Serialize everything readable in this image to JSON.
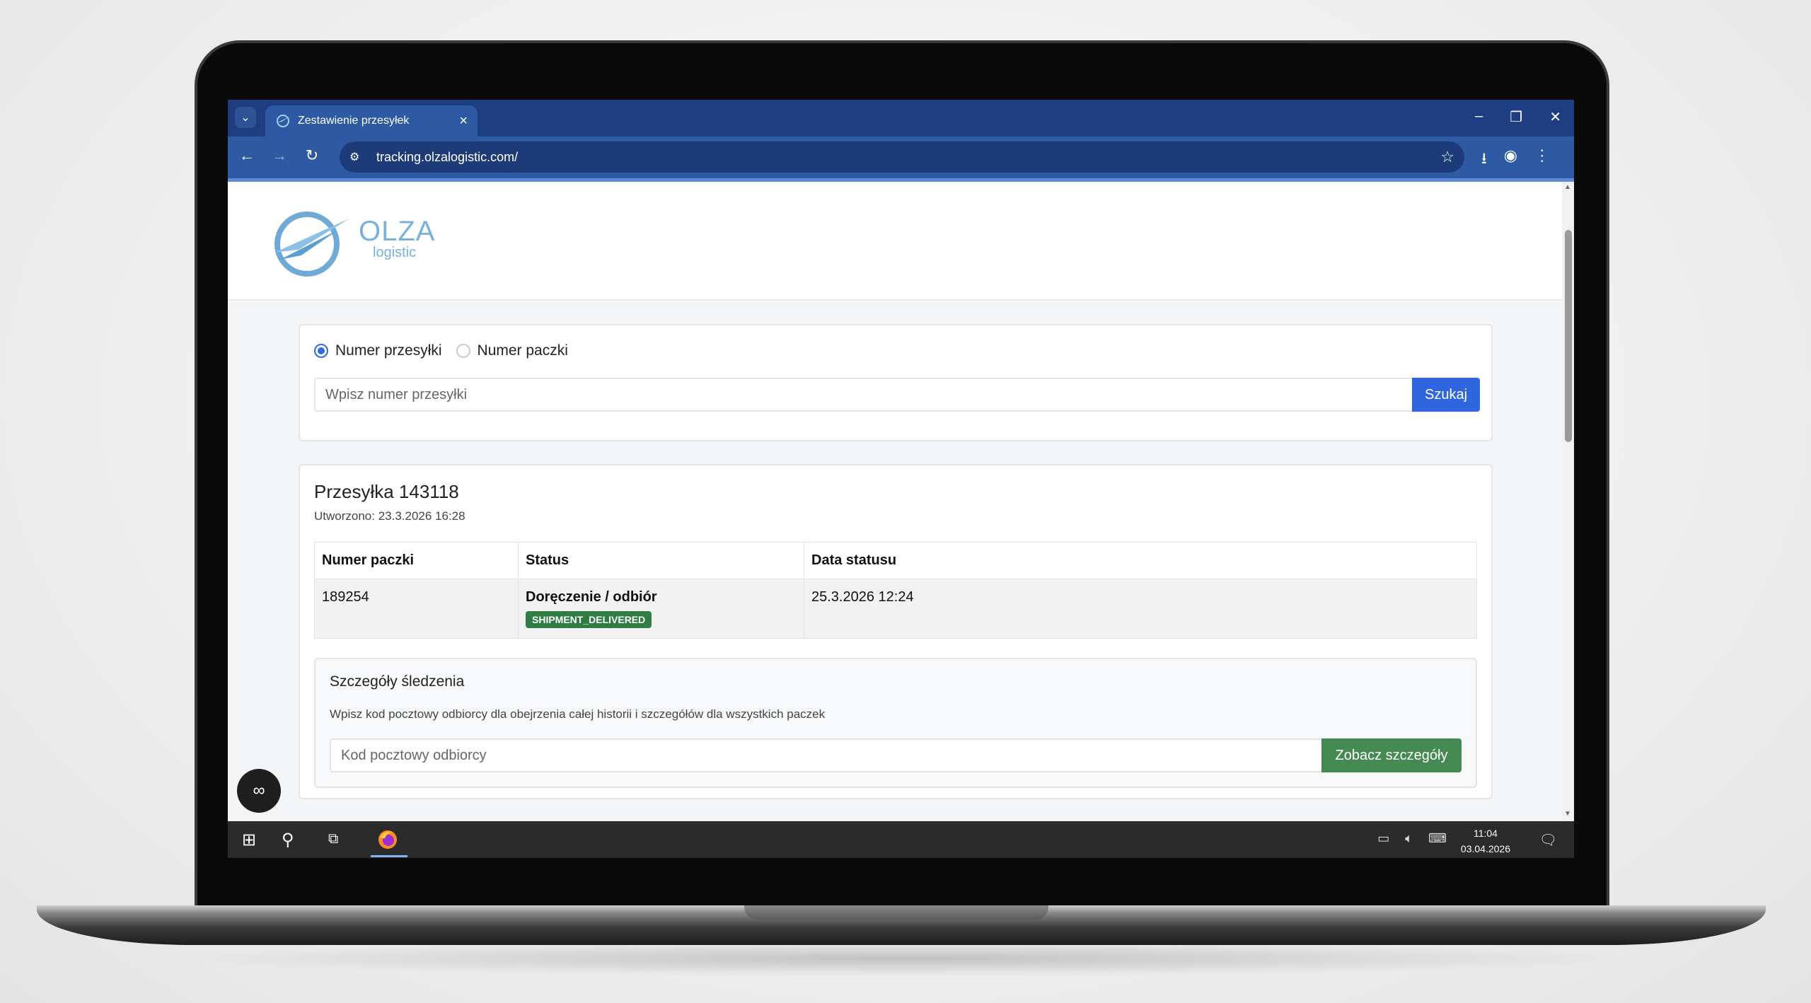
{
  "browser": {
    "tab_title": "Zestawienie przesyłek",
    "url": "tracking.olzalogistic.com/"
  },
  "logo": {
    "main": "OLZA",
    "sub": "logistic"
  },
  "search": {
    "radio_shipment": "Numer przesyłki",
    "radio_package": "Numer paczki",
    "placeholder": "Wpisz numer przesyłki",
    "button": "Szukaj"
  },
  "shipment": {
    "title": "Przesyłka 143118",
    "created": "Utworzono: 23.3.2026 16:28",
    "columns": [
      "Numer paczki",
      "Status",
      "Data statusu"
    ],
    "row": {
      "package": "189254",
      "status": "Doręczenie / odbiór",
      "badge": "SHIPMENT_DELIVERED",
      "date": "25.3.2026 12:24"
    }
  },
  "details": {
    "title": "Szczegóły śledzenia",
    "description": "Wpisz kod pocztowy odbiorcy dla obejrzenia całej historii i szczegółów dla wszystkich paczek",
    "placeholder": "Kod pocztowy odbiorcy",
    "button": "Zobacz szczegóły"
  },
  "taskbar": {
    "time": "11:04",
    "date": "03.04.2026"
  },
  "colors": {
    "primary": "#2f66df",
    "success": "#458a52",
    "badge": "#2f7d43",
    "chrome": "#2e5aa4",
    "logo": "#79b1db"
  }
}
